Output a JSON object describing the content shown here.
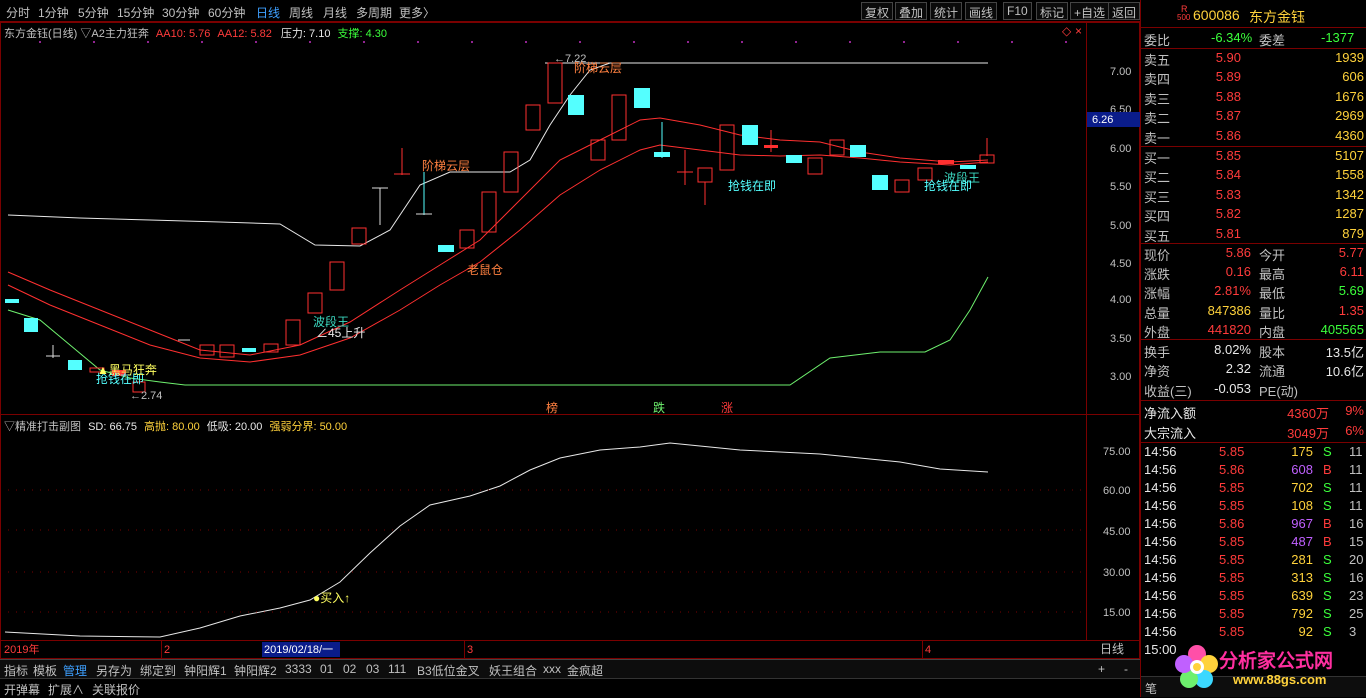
{
  "toolbar": {
    "periods": [
      "分时",
      "1分钟",
      "5分钟",
      "15分钟",
      "30分钟",
      "60分钟",
      "日线",
      "周线",
      "月线",
      "多周期",
      "更多〉"
    ],
    "active_period": "日线",
    "right_buttons": [
      "复权",
      "叠加",
      "统计",
      "画线",
      "F10",
      "标记",
      "+自选",
      "返回"
    ]
  },
  "main_info": {
    "name": "东方金钰(日线)",
    "indicator": "▽A2主力狂奔",
    "aa10": "AA10: 5.76",
    "aa12": "AA12: 5.82",
    "pressure": "压力: 7.10",
    "support": "支撑: 4.30"
  },
  "sub_info": {
    "name": "▽精准打击副图",
    "sd": "SD: 66.75",
    "high": "高抛: 80.00",
    "low": "低吸: 20.00",
    "boundary": "强弱分界: 50.00"
  },
  "main_axis": [
    "7.00",
    "6.50",
    "6.00",
    "5.50",
    "5.00",
    "4.50",
    "4.00",
    "3.50",
    "3.00"
  ],
  "price_tag": "6.26",
  "sub_axis": [
    "75.00",
    "60.00",
    "45.00",
    "30.00",
    "15.00"
  ],
  "annotations": {
    "high": "←7.22",
    "low": "←2.74",
    "stair1": "阶梯云层",
    "stair2": "阶梯云层",
    "rat": "老鼠仓",
    "band1": "波段王",
    "band2": "波段王",
    "rise45": "∠45上升",
    "jiezhong": "抢钱在即",
    "jiezhong2": "抢钱在即",
    "jiezhong3": "抢钱在即",
    "kuangben": "▲黑马狂奔",
    "buy": "●买入↑",
    "m1": "榜",
    "m2": "跌",
    "m3": "涨"
  },
  "date_axis": {
    "y2019": "2019年",
    "m2": "2",
    "cursor": "2019/02/18/一",
    "m3": "3",
    "m4": "4",
    "period": "日线"
  },
  "bottom_tabs": [
    "指标",
    "模板",
    "管理",
    "另存为",
    "绑定到",
    "钟阳辉1",
    "钟阳辉2",
    "3333",
    "01",
    "02",
    "03",
    "111",
    "B3低位金叉",
    "妖王组合",
    "xxx",
    "金疯超"
  ],
  "bottom_active": "管理",
  "bottom2": [
    "开弹幕",
    "扩展∧",
    "关联报价"
  ],
  "quote": {
    "code": "600086",
    "name": "东方金钰",
    "badge_r": "R",
    "badge_500": "500",
    "weibi_label": "委比",
    "weibi": "-6.34%",
    "weicha_label": "委差",
    "weicha": "-1377",
    "asks": [
      {
        "label": "卖五",
        "price": "5.90",
        "vol": "1939"
      },
      {
        "label": "卖四",
        "price": "5.89",
        "vol": "606"
      },
      {
        "label": "卖三",
        "price": "5.88",
        "vol": "1676"
      },
      {
        "label": "卖二",
        "price": "5.87",
        "vol": "2969"
      },
      {
        "label": "卖一",
        "price": "5.86",
        "vol": "4360"
      }
    ],
    "bids": [
      {
        "label": "买一",
        "price": "5.85",
        "vol": "5107"
      },
      {
        "label": "买二",
        "price": "5.84",
        "vol": "1558"
      },
      {
        "label": "买三",
        "price": "5.83",
        "vol": "1342"
      },
      {
        "label": "买四",
        "price": "5.82",
        "vol": "1287"
      },
      {
        "label": "买五",
        "price": "5.81",
        "vol": "879"
      }
    ],
    "stats": [
      {
        "l1": "现价",
        "v1": "5.86",
        "l2": "今开",
        "v2": "5.77"
      },
      {
        "l1": "涨跌",
        "v1": "0.16",
        "l2": "最高",
        "v2": "6.11"
      },
      {
        "l1": "涨幅",
        "v1": "2.81%",
        "l2": "最低",
        "v2": "5.69"
      },
      {
        "l1": "总量",
        "v1": "847386",
        "l2": "量比",
        "v2": "1.35"
      },
      {
        "l1": "外盘",
        "v1": "441820",
        "l2": "内盘",
        "v2": "405565"
      }
    ],
    "stats2": [
      {
        "l1": "换手",
        "v1": "8.02%",
        "l2": "股本",
        "v2": "13.5亿"
      },
      {
        "l1": "净资",
        "v1": "2.32",
        "l2": "流通",
        "v2": "10.6亿"
      },
      {
        "l1": "收益(三)",
        "v1": "-0.053",
        "l2": "PE(动)",
        "v2": ""
      }
    ],
    "flow": [
      {
        "label": "净流入额",
        "value": "4360万",
        "pct": "9%"
      },
      {
        "label": "大宗流入",
        "value": "3049万",
        "pct": "6%"
      }
    ],
    "ticks": [
      {
        "t": "14:56",
        "p": "5.85",
        "v": "175",
        "bs": "S",
        "n": "11"
      },
      {
        "t": "14:56",
        "p": "5.86",
        "v": "608",
        "bs": "B",
        "n": "11"
      },
      {
        "t": "14:56",
        "p": "5.85",
        "v": "702",
        "bs": "S",
        "n": "11"
      },
      {
        "t": "14:56",
        "p": "5.85",
        "v": "108",
        "bs": "S",
        "n": "11"
      },
      {
        "t": "14:56",
        "p": "5.86",
        "v": "967",
        "bs": "B",
        "n": "16"
      },
      {
        "t": "14:56",
        "p": "5.85",
        "v": "487",
        "bs": "B",
        "n": "15"
      },
      {
        "t": "14:56",
        "p": "5.85",
        "v": "281",
        "bs": "S",
        "n": "20"
      },
      {
        "t": "14:56",
        "p": "5.85",
        "v": "313",
        "bs": "S",
        "n": "16"
      },
      {
        "t": "14:56",
        "p": "5.85",
        "v": "639",
        "bs": "S",
        "n": "23"
      },
      {
        "t": "14:56",
        "p": "5.85",
        "v": "792",
        "bs": "S",
        "n": "25"
      },
      {
        "t": "14:56",
        "p": "5.85",
        "v": "92",
        "bs": "S",
        "n": "3"
      },
      {
        "t": "15:00",
        "p": "",
        "v": "",
        "bs": "",
        "n": ""
      }
    ],
    "footer": "笔"
  },
  "watermark": {
    "title": "分析家公式网",
    "url": "www.88gs.com"
  },
  "colors": {
    "up": "#ff3b3b",
    "down": "#54ffff",
    "frame": "#7a0000"
  }
}
